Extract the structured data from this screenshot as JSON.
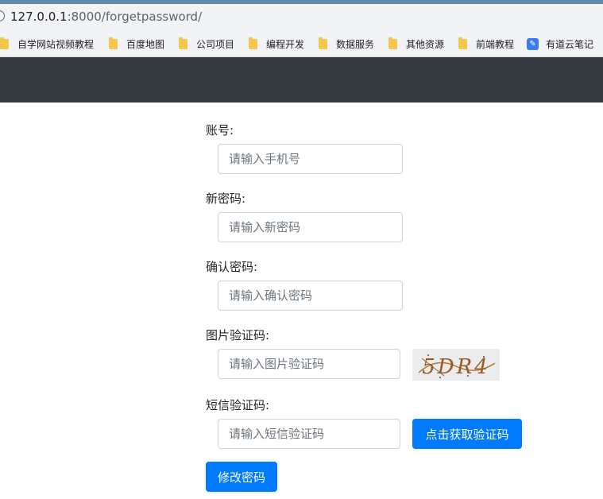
{
  "browser": {
    "url_host": "127.0.0.1",
    "url_rest": ":8000/forgetpassword/",
    "bookmarks": [
      {
        "label": "自学网站视频教程",
        "icon": "folder-icon"
      },
      {
        "label": "百度地图",
        "icon": "folder-icon"
      },
      {
        "label": "公司项目",
        "icon": "folder-icon"
      },
      {
        "label": "编程开发",
        "icon": "folder-icon"
      },
      {
        "label": "数据服务",
        "icon": "folder-icon"
      },
      {
        "label": "其他资源",
        "icon": "folder-icon"
      },
      {
        "label": "前端教程",
        "icon": "folder-icon"
      },
      {
        "label": "有道云笔记",
        "icon": "note-icon"
      }
    ]
  },
  "form": {
    "account_label": "账号:",
    "account_placeholder": "请输入手机号",
    "new_password_label": "新密码:",
    "new_password_placeholder": "请输入新密码",
    "confirm_password_label": "确认密码:",
    "confirm_password_placeholder": "请输入确认密码",
    "image_captcha_label": "图片验证码:",
    "image_captcha_placeholder": "请输入图片验证码",
    "captcha_image_text": "5DR4",
    "sms_code_label": "短信验证码:",
    "sms_code_placeholder": "请输入短信验证码",
    "get_code_button": "点击获取验证码",
    "submit_button": "修改密码"
  },
  "colors": {
    "navbar": "#343a40",
    "primary": "#007bff"
  }
}
